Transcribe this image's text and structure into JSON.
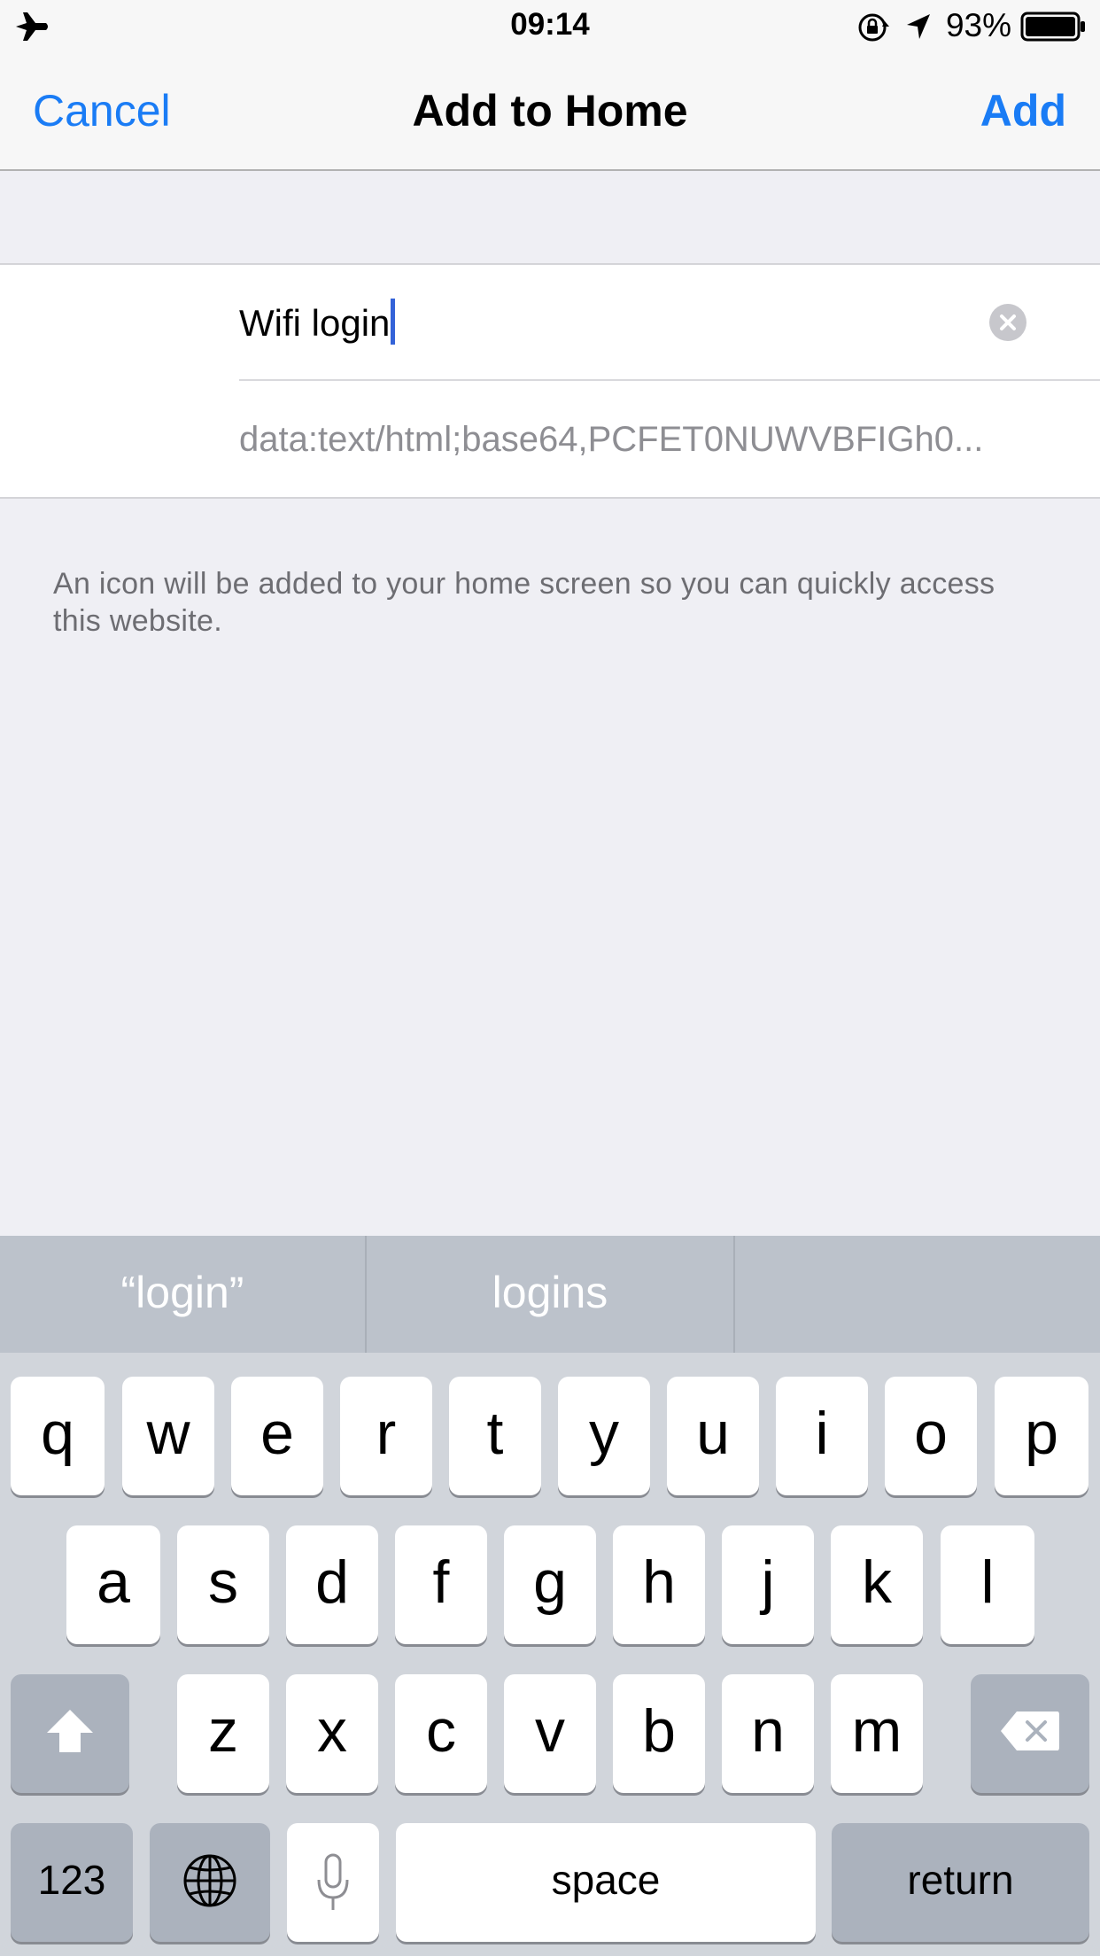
{
  "status_bar": {
    "time": "09:14",
    "battery": "93%",
    "icons": [
      "airplane-icon",
      "rotation-lock-icon",
      "location-arrow-icon",
      "battery-icon"
    ]
  },
  "nav": {
    "cancel_label": "Cancel",
    "title": "Add to Home",
    "add_label": "Add"
  },
  "form": {
    "name_value": "Wifi login",
    "url_value": "data:text/html;base64,PCFET0NUWVBFIGh0..."
  },
  "footer_note": "An icon will be added to your home screen so you can quickly access this website.",
  "keyboard": {
    "suggestions": [
      "“login”",
      "logins",
      ""
    ],
    "row1": [
      "q",
      "w",
      "e",
      "r",
      "t",
      "y",
      "u",
      "i",
      "o",
      "p"
    ],
    "row2": [
      "a",
      "s",
      "d",
      "f",
      "g",
      "h",
      "j",
      "k",
      "l"
    ],
    "row3": [
      "z",
      "x",
      "c",
      "v",
      "b",
      "n",
      "m"
    ],
    "numbers_label": "123",
    "space_label": "space",
    "return_label": "return"
  },
  "colors": {
    "accent": "#1a7cf5",
    "caret": "#3463d8",
    "background": "#efeff4",
    "keyboard_bg": "#d1d5db"
  }
}
